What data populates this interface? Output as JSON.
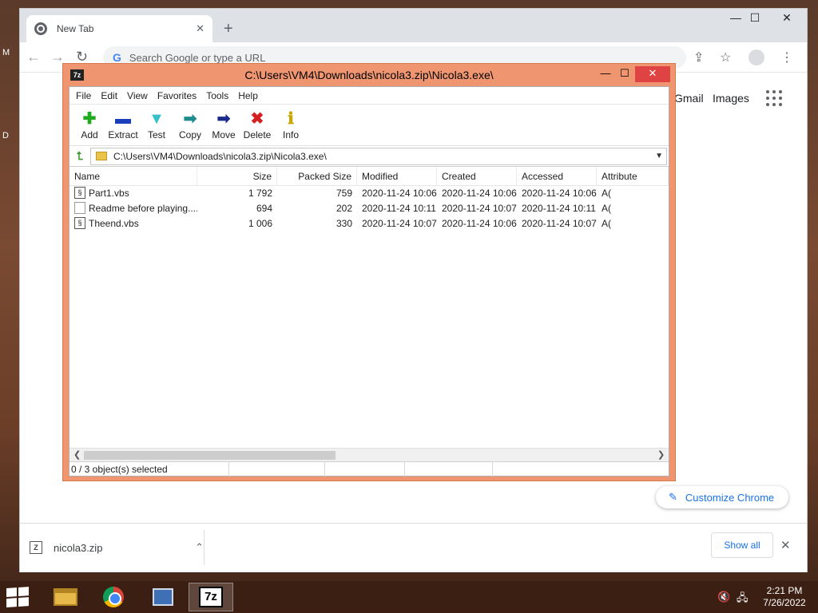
{
  "desktop": {
    "letters": [
      "M",
      "D"
    ]
  },
  "chrome": {
    "tab_title": "New Tab",
    "tab_close": "✕",
    "new_tab": "+",
    "window_controls": [
      "—",
      "☐",
      "✕"
    ],
    "omnibox_placeholder": "Search Google or type a URL",
    "gmail": "Gmail",
    "images": "Images",
    "customize": "Customize Chrome",
    "download": {
      "file": "nicola3.zip",
      "show_all": "Show all"
    }
  },
  "sevenzip": {
    "icon_text": "7z",
    "title": "C:\\Users\\VM4\\Downloads\\nicola3.zip\\Nicola3.exe\\",
    "menu": [
      "File",
      "Edit",
      "View",
      "Favorites",
      "Tools",
      "Help"
    ],
    "toolbar": [
      {
        "label": "Add",
        "icon": "plus-icon",
        "glyph": "✚",
        "color": "#1faa1f"
      },
      {
        "label": "Extract",
        "icon": "minus-icon",
        "glyph": "▬",
        "color": "#1a3fb8"
      },
      {
        "label": "Test",
        "icon": "check-down-icon",
        "glyph": "▼",
        "color": "#36c0c8"
      },
      {
        "label": "Copy",
        "icon": "arrow-right-copy-icon",
        "glyph": "➡",
        "color": "#1e8c8c"
      },
      {
        "label": "Move",
        "icon": "arrow-right-move-icon",
        "glyph": "➡",
        "color": "#1a2a8a"
      },
      {
        "label": "Delete",
        "icon": "delete-x-icon",
        "glyph": "✖",
        "color": "#d42020"
      },
      {
        "label": "Info",
        "icon": "info-icon",
        "glyph": "ℹ",
        "color": "#c8a800"
      }
    ],
    "address": "C:\\Users\\VM4\\Downloads\\nicola3.zip\\Nicola3.exe\\",
    "columns": [
      "Name",
      "Size",
      "Packed Size",
      "Modified",
      "Created",
      "Accessed",
      "Attribute"
    ],
    "rows": [
      {
        "name": "Part1.vbs",
        "size": "1 792",
        "packed": "759",
        "modified": "2020-11-24 10:06",
        "created": "2020-11-24 10:06",
        "accessed": "2020-11-24 10:06",
        "attr": "A(",
        "icon": "script-file-icon"
      },
      {
        "name": "Readme before playing....",
        "size": "694",
        "packed": "202",
        "modified": "2020-11-24 10:11",
        "created": "2020-11-24 10:07",
        "accessed": "2020-11-24 10:11",
        "attr": "A(",
        "icon": "text-file-icon"
      },
      {
        "name": "Theend.vbs",
        "size": "1 006",
        "packed": "330",
        "modified": "2020-11-24 10:07",
        "created": "2020-11-24 10:06",
        "accessed": "2020-11-24 10:07",
        "attr": "A(",
        "icon": "script-file-icon"
      }
    ],
    "status": "0 / 3 object(s) selected"
  },
  "taskbar": {
    "time": "2:21 PM",
    "date": "7/26/2022"
  }
}
